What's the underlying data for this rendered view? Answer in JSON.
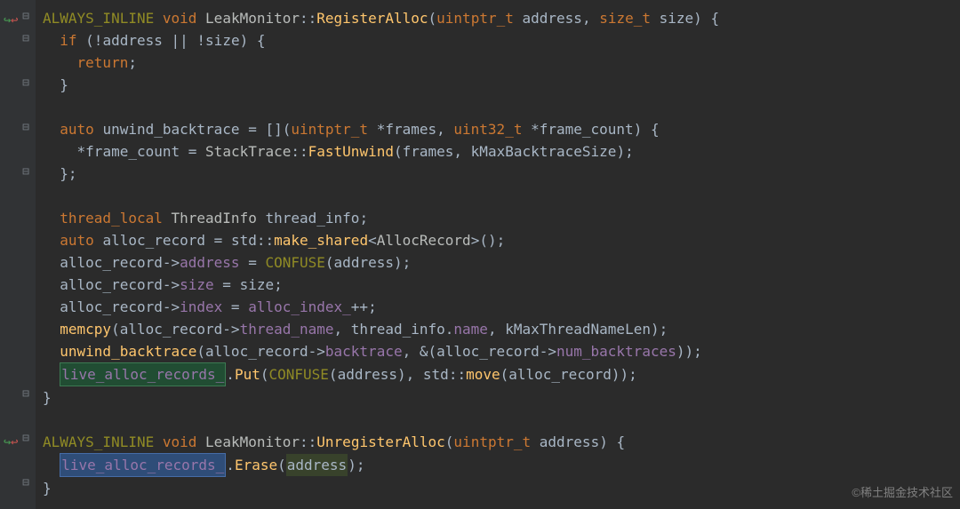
{
  "watermark": "©稀土掘金技术社区",
  "tokens": {
    "kw_void": "void",
    "kw_if": "if",
    "kw_return": "return",
    "kw_auto": "auto",
    "kw_thread_local": "thread_local",
    "kw_size_t": "size_t",
    "kw_uint32_t": "uint32_t",
    "kw_uintptr_t": "uintptr_t",
    "ALWAYS_INLINE": "ALWAYS_INLINE",
    "LeakMonitor": "LeakMonitor",
    "RegisterAlloc": "RegisterAlloc",
    "UnregisterAlloc": "UnregisterAlloc",
    "address": "address",
    "size": "size",
    "unwind_backtrace": "unwind_backtrace",
    "frames": "frames",
    "frame_count": "frame_count",
    "StackTrace": "StackTrace",
    "FastUnwind": "FastUnwind",
    "kMaxBacktraceSize": "kMaxBacktraceSize",
    "ThreadInfo": "ThreadInfo",
    "thread_info": "thread_info",
    "alloc_record": "alloc_record",
    "std": "std",
    "make_shared": "make_shared",
    "AllocRecord": "AllocRecord",
    "CONFUSE": "CONFUSE",
    "index": "index",
    "alloc_index_": "alloc_index_",
    "memcpy": "memcpy",
    "thread_name": "thread_name",
    "name": "name",
    "kMaxThreadNameLen": "kMaxThreadNameLen",
    "backtrace": "backtrace",
    "num_backtraces": "num_backtraces",
    "live_alloc_records_": "live_alloc_records_",
    "Put": "Put",
    "move": "move",
    "Erase": "Erase"
  },
  "fold_icons": {
    "open": "⊟",
    "close": "⊟",
    "end": "⊟"
  },
  "vcs_glyph": "↪"
}
